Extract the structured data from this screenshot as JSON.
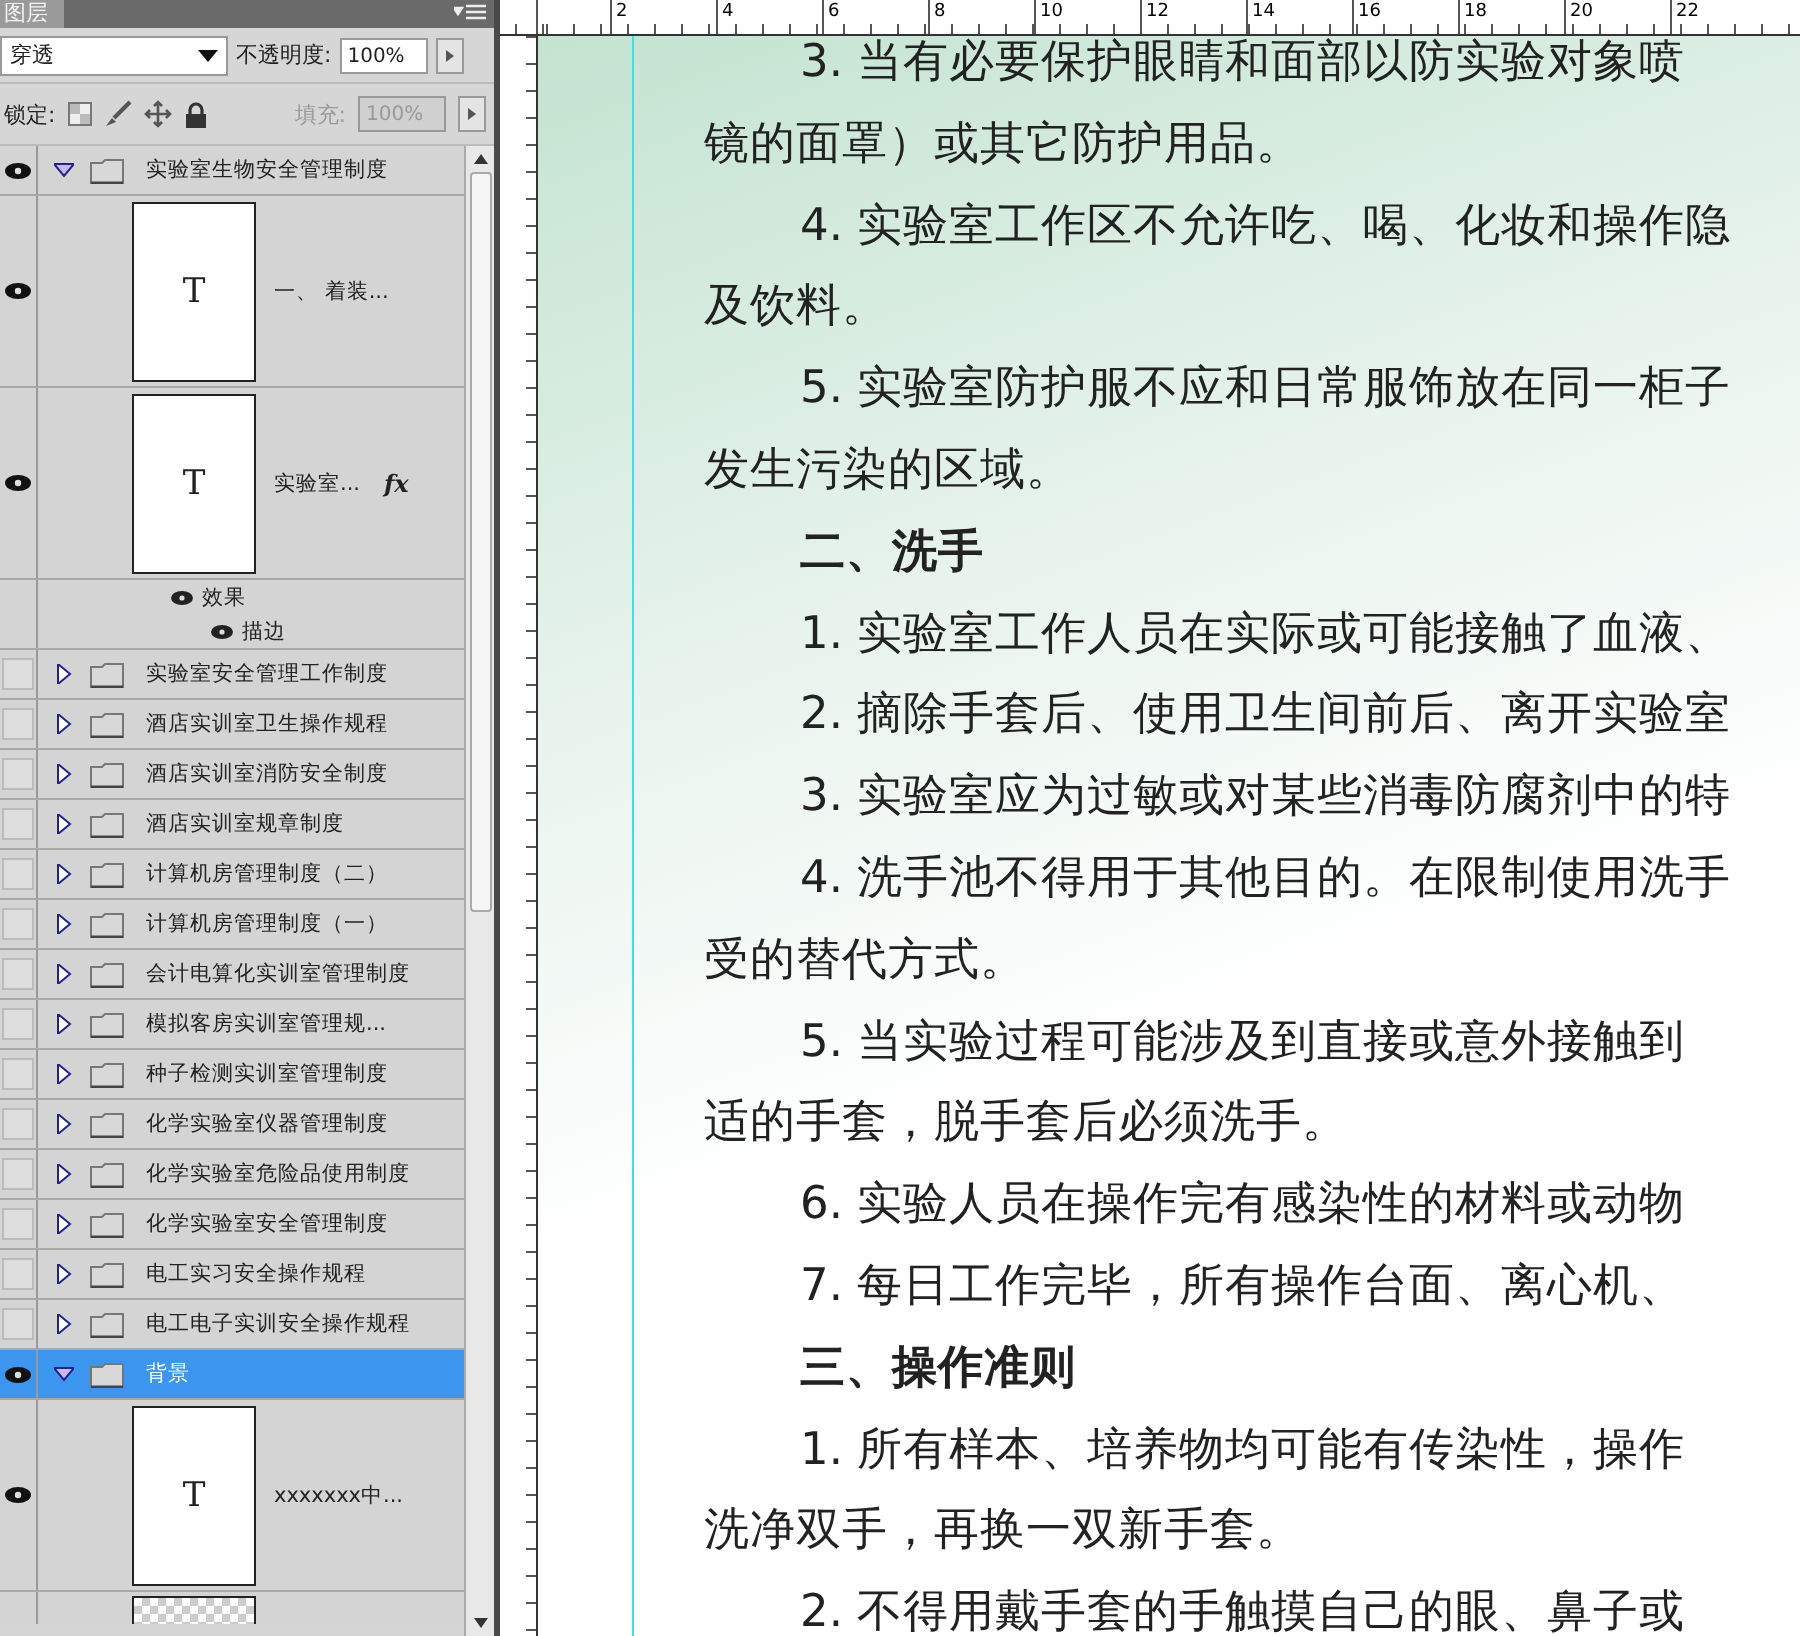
{
  "panel": {
    "tab": "图层",
    "blend_mode": "穿透",
    "opacity_label": "不透明度:",
    "opacity": "100%",
    "lock_label": "锁定:",
    "fill_label": "填充:",
    "fill": "100%",
    "fill_disabled": true
  },
  "layers": [
    {
      "kind": "group",
      "name": "实验室生物安全管理制度",
      "visible": true,
      "expanded": true,
      "selected": false,
      "children": [
        {
          "kind": "text",
          "name": "一、 着装...",
          "visible": true,
          "thumb": "T"
        },
        {
          "kind": "text",
          "name": "实验室...",
          "visible": true,
          "thumb": "T",
          "fx": "fx",
          "effects_label": "效果",
          "effects": [
            "描边"
          ]
        }
      ]
    },
    {
      "kind": "group",
      "name": "实验室安全管理工作制度",
      "visible": false,
      "expanded": false,
      "selected": false
    },
    {
      "kind": "group",
      "name": "酒店实训室卫生操作规程",
      "visible": false,
      "expanded": false,
      "selected": false
    },
    {
      "kind": "group",
      "name": "酒店实训室消防安全制度",
      "visible": false,
      "expanded": false,
      "selected": false
    },
    {
      "kind": "group",
      "name": "酒店实训室规章制度",
      "visible": false,
      "expanded": false,
      "selected": false
    },
    {
      "kind": "group",
      "name": "计算机房管理制度（二）",
      "visible": false,
      "expanded": false,
      "selected": false
    },
    {
      "kind": "group",
      "name": "计算机房管理制度（一）",
      "visible": false,
      "expanded": false,
      "selected": false
    },
    {
      "kind": "group",
      "name": "会计电算化实训室管理制度",
      "visible": false,
      "expanded": false,
      "selected": false
    },
    {
      "kind": "group",
      "name": "模拟客房实训室管理规...",
      "visible": false,
      "expanded": false,
      "selected": false
    },
    {
      "kind": "group",
      "name": "种子检测实训室管理制度",
      "visible": false,
      "expanded": false,
      "selected": false
    },
    {
      "kind": "group",
      "name": "化学实验室仪器管理制度",
      "visible": false,
      "expanded": false,
      "selected": false
    },
    {
      "kind": "group",
      "name": "化学实验室危险品使用制度",
      "visible": false,
      "expanded": false,
      "selected": false
    },
    {
      "kind": "group",
      "name": "化学实验室安全管理制度",
      "visible": false,
      "expanded": false,
      "selected": false
    },
    {
      "kind": "group",
      "name": "电工实习安全操作规程",
      "visible": false,
      "expanded": false,
      "selected": false
    },
    {
      "kind": "group",
      "name": "电工电子实训安全操作规程",
      "visible": false,
      "expanded": false,
      "selected": false
    },
    {
      "kind": "group",
      "name": "背景",
      "visible": true,
      "expanded": true,
      "selected": true,
      "children": [
        {
          "kind": "text",
          "name": "xxxxxxx中...",
          "visible": true,
          "thumb": "T"
        },
        {
          "kind": "raster"
        }
      ]
    }
  ],
  "document": {
    "ruler": [
      "2",
      "4",
      "6",
      "8",
      "10",
      "12",
      "14",
      "16",
      "18",
      "20",
      "22"
    ],
    "paragraphs": [
      {
        "kind": "item",
        "text": "3. 当有必要保护眼睛和面部以防实验对象喷"
      },
      {
        "kind": "cont",
        "text": "镜的面罩）或其它防护用品。"
      },
      {
        "kind": "item",
        "text": "4. 实验室工作区不允许吃、喝、化妆和操作隐"
      },
      {
        "kind": "cont",
        "text": "及饮料。"
      },
      {
        "kind": "item",
        "text": "5. 实验室防护服不应和日常服饰放在同一柜子"
      },
      {
        "kind": "cont",
        "text": "发生污染的区域。"
      },
      {
        "kind": "heading",
        "text": "二、洗手"
      },
      {
        "kind": "item",
        "text": "1. 实验室工作人员在实际或可能接触了血液、"
      },
      {
        "kind": "item",
        "text": "2. 摘除手套后、使用卫生间前后、离开实验室"
      },
      {
        "kind": "item",
        "text": "3. 实验室应为过敏或对某些消毒防腐剂中的特"
      },
      {
        "kind": "item",
        "text": "4. 洗手池不得用于其他目的。在限制使用洗手"
      },
      {
        "kind": "cont",
        "text": "受的替代方式。"
      },
      {
        "kind": "item",
        "text": "5. 当实验过程可能涉及到直接或意外接触到"
      },
      {
        "kind": "cont",
        "text": "适的手套，脱手套后必须洗手。"
      },
      {
        "kind": "item",
        "text": "6. 实验人员在操作完有感染性的材料或动物"
      },
      {
        "kind": "item",
        "text": "7. 每日工作完毕，所有操作台面、离心机、"
      },
      {
        "kind": "heading",
        "text": "三、操作准则"
      },
      {
        "kind": "item",
        "text": "1. 所有样本、培养物均可能有传染性，操作"
      },
      {
        "kind": "cont",
        "text": "洗净双手，再换一双新手套。"
      },
      {
        "kind": "item",
        "text": "2. 不得用戴手套的手触摸自己的眼、鼻子或"
      }
    ]
  }
}
